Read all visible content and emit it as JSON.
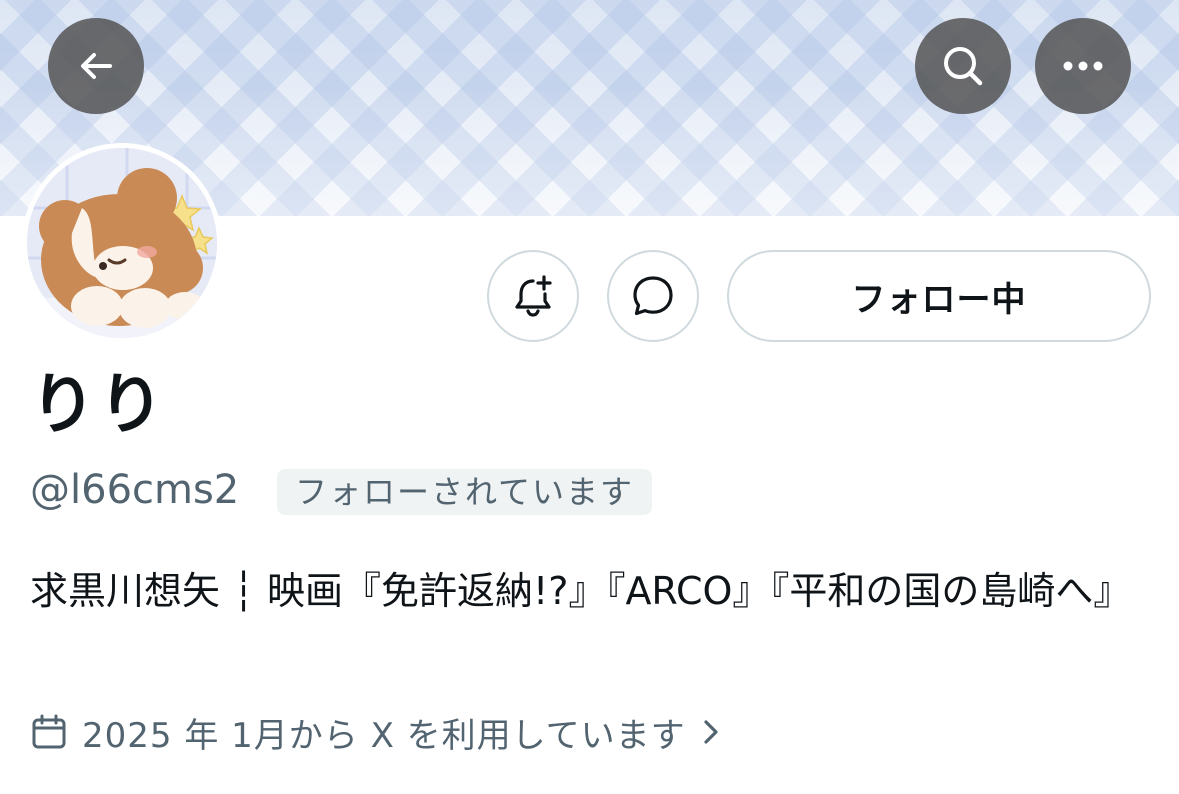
{
  "header": {
    "back_icon": "arrow-left-icon",
    "search_icon": "search-icon",
    "more_icon": "more-horizontal-icon"
  },
  "profile": {
    "display_name": "りり",
    "handle": "@l66cms2",
    "follows_you_badge": "フォローされています",
    "bio": "求黒川想矢 ┆ 映画『免許返納!?』『ARCO』『平和の国の島崎へ』",
    "joined": "2025 年 1月から X を利用しています"
  },
  "actions": {
    "notification_icon": "bell-plus-icon",
    "message_icon": "message-bubble-icon",
    "follow_label": "フォロー中"
  },
  "colors": {
    "primary_text": "#0f1419",
    "secondary_text": "#536471",
    "border": "#cfd9de",
    "badge_bg": "#eff3f4"
  }
}
